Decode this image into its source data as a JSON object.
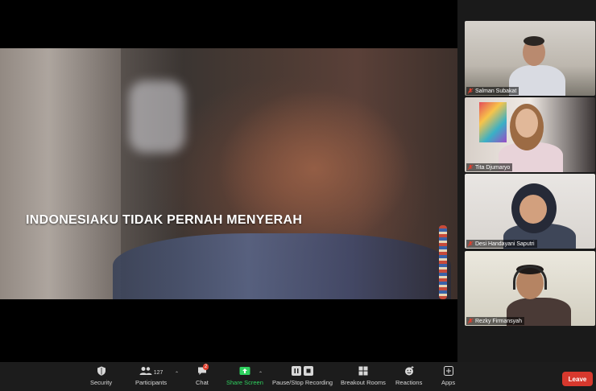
{
  "shared_video": {
    "caption": "INDONESIAKU TIDAK PERNAH MENYERAH"
  },
  "gallery": {
    "participants": [
      {
        "name": "Salman Subakat",
        "muted": true
      },
      {
        "name": "Tita Djumaryo",
        "muted": true
      },
      {
        "name": "Desi Handayani Saputri",
        "muted": true
      },
      {
        "name": "Rezky Firmansyah",
        "muted": true
      }
    ]
  },
  "toolbar": {
    "security_label": "Security",
    "participants_label": "Participants",
    "participants_count": "127",
    "chat_label": "Chat",
    "chat_badge": "2",
    "share_label": "Share Screen",
    "record_label": "Pause/Stop Recording",
    "breakout_label": "Breakout Rooms",
    "reactions_label": "Reactions",
    "apps_label": "Apps",
    "leave_label": "Leave"
  },
  "colors": {
    "toolbar_bg": "#1c1c1c",
    "share_green": "#2fd15f",
    "leave_red": "#d7382d",
    "badge_red": "#e0402f"
  }
}
